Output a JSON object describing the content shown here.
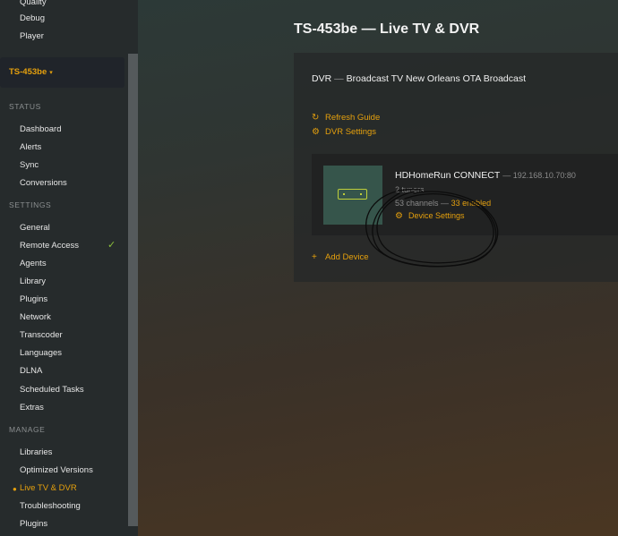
{
  "sidebar": {
    "top_items": [
      {
        "label": "Quality"
      },
      {
        "label": "Debug"
      },
      {
        "label": "Player"
      }
    ],
    "server": {
      "name": "TS-453be",
      "caret": "▾"
    },
    "sections": {
      "status": "STATUS",
      "settings": "SETTINGS",
      "manage": "MANAGE"
    },
    "status_items": [
      "Dashboard",
      "Alerts",
      "Sync",
      "Conversions"
    ],
    "settings_items": [
      "General",
      "Remote Access",
      "Agents",
      "Library",
      "Plugins",
      "Network",
      "Transcoder",
      "Languages",
      "DLNA",
      "Scheduled Tasks",
      "Extras"
    ],
    "manage_items": [
      "Libraries",
      "Optimized Versions",
      "Live TV & DVR",
      "Troubleshooting",
      "Plugins"
    ],
    "remote_access_check": "✓",
    "active_item": "Live TV & DVR"
  },
  "main": {
    "title": "TS-453be — Live TV & DVR",
    "dvr": {
      "label": "DVR",
      "separator": "—",
      "name": "Broadcast TV New Orleans OTA Broadcast"
    },
    "links": {
      "refresh_guide": "Refresh Guide",
      "dvr_settings": "DVR Settings",
      "add_device": "Add Device"
    },
    "device": {
      "name": "HDHomeRun CONNECT",
      "ip": "— 192.168.10.70:80",
      "tuners": "2 tuners",
      "channels": "53 channels —",
      "enabled": "33 enabled",
      "settings_label": "Device Settings"
    }
  },
  "colors": {
    "accent": "#e5a00d",
    "check": "#8bbf3c",
    "device_thumb": "#36554b"
  }
}
